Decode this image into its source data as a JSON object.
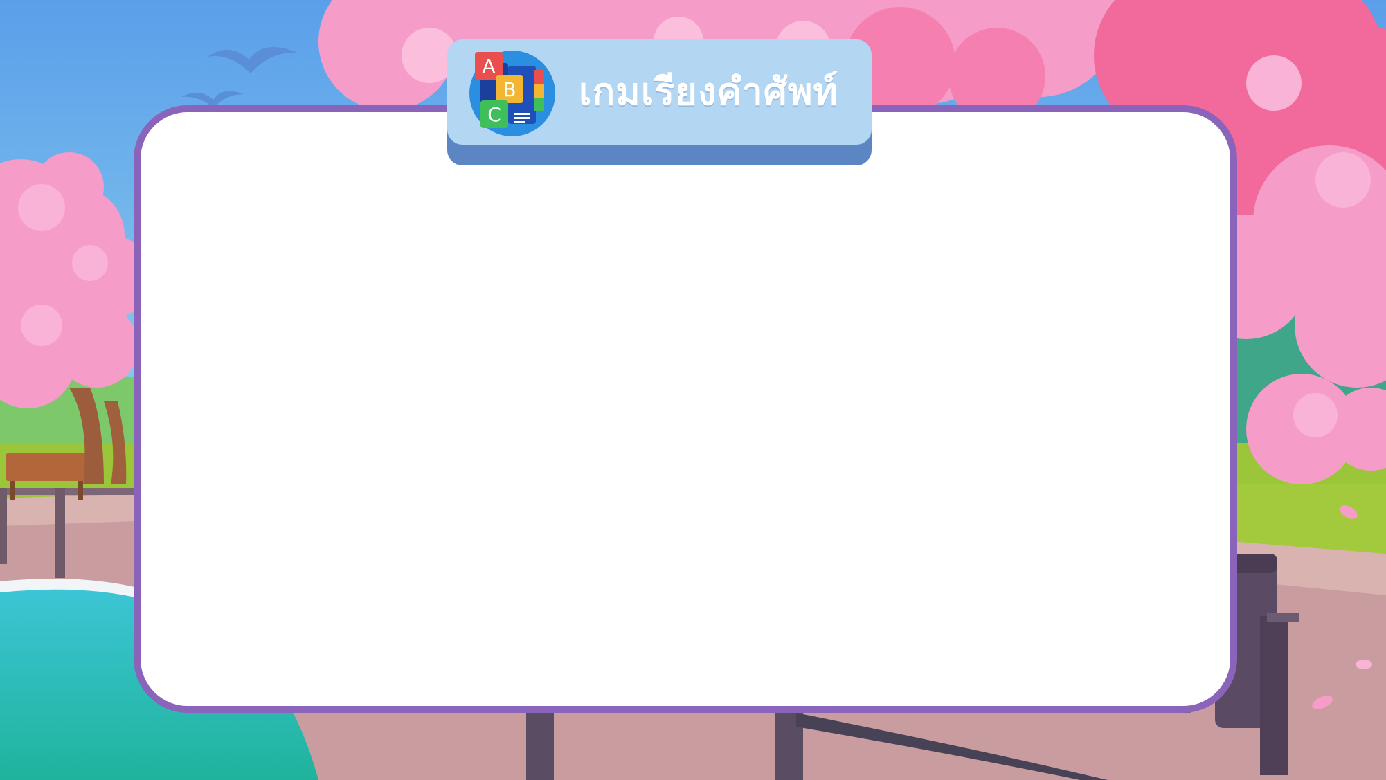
{
  "game": {
    "title": "เกมเรียงคำศัพท์",
    "title_icon": "abc-blocks-icon",
    "blocks": [
      "A",
      "B",
      "C"
    ]
  },
  "colors": {
    "panel_border": "#8a63ba",
    "tab_face": "#b3d6f2",
    "tab_shadow": "#5b86c3",
    "sky": "#5fa6ea",
    "blossom": "#f59cc8",
    "water": "#26c6c6",
    "grass": "#9cc63a"
  }
}
